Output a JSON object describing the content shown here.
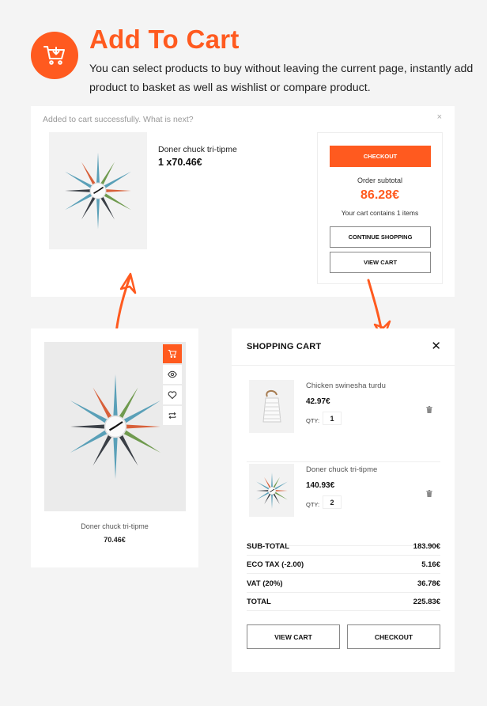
{
  "header": {
    "icon": "cart-download-icon",
    "title": "Add To Cart",
    "description": "You can select products to buy without leaving the current page, instantly add product to basket as well as wishlist or compare product."
  },
  "popup": {
    "message": "Added to cart successfully. What is next?",
    "close_label": "×",
    "product": {
      "name": "Doner chuck tri-tipme",
      "quantity_price": "1 x70.46€",
      "image": "starburst-clock"
    },
    "checkout_label": "CHECKOUT",
    "subtotal_label": "Order subtotal",
    "subtotal_value": "86.28€",
    "cart_count_text": "Your cart contains 1 items",
    "continue_label": "CONTINUE SHOPPING",
    "view_cart_label": "VIEW CART"
  },
  "product_card": {
    "name": "Doner chuck tri-tipme",
    "price": "70.46€",
    "image": "starburst-clock",
    "actions": [
      {
        "icon": "cart-icon",
        "active": true
      },
      {
        "icon": "eye-icon",
        "active": false
      },
      {
        "icon": "heart-icon",
        "active": false
      },
      {
        "icon": "compare-icon",
        "active": false
      }
    ]
  },
  "cart": {
    "title": "SHOPPING CART",
    "close_label": "✕",
    "items": [
      {
        "name": "Chicken swinesha turdu",
        "price": "42.97€",
        "qty_label": "QTY:",
        "qty": "1",
        "image": "white-lantern"
      },
      {
        "name": "Doner chuck tri-tipme",
        "price": "140.93€",
        "qty_label": "QTY:",
        "qty": "2",
        "image": "starburst-clock"
      }
    ],
    "totals": [
      {
        "label": "SUB-TOTAL",
        "value": "183.90€"
      },
      {
        "label": "ECO TAX (-2.00)",
        "value": "5.16€"
      },
      {
        "label": "VAT (20%)",
        "value": "36.78€"
      },
      {
        "label": "TOTAL",
        "value": "225.83€"
      }
    ],
    "view_cart_label": "VIEW CART",
    "checkout_label": "CHECKOUT"
  },
  "colors": {
    "accent": "#ff5a1f",
    "background": "#f4f4f4"
  }
}
